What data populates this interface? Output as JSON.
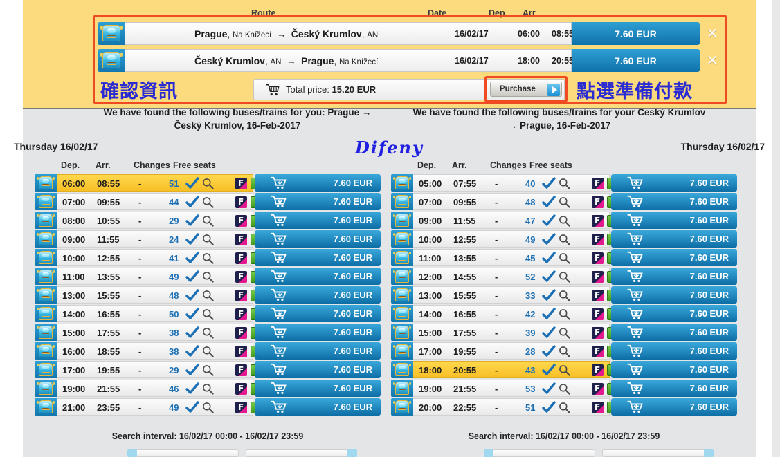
{
  "banner": {
    "columns": {
      "route": "Route",
      "date": "Date",
      "dep": "Dep.",
      "arr": "Arr."
    },
    "items": [
      {
        "from_city": "Prague",
        "from_stop": "Na Knížecí",
        "to_city": "Český Krumlov",
        "to_stop": "AN",
        "date": "16/02/17",
        "dep": "06:00",
        "arr": "08:55",
        "price": "7.60 EUR",
        "remove": "✕"
      },
      {
        "from_city": "Český Krumlov",
        "from_stop": "AN",
        "to_city": "Prague",
        "to_stop": "Na Knížecí",
        "date": "16/02/17",
        "dep": "18:00",
        "arr": "20:55",
        "price": "7.60 EUR",
        "remove": "✕"
      }
    ],
    "annotation_left": "確認資訊",
    "annotation_right": "點選準備付款",
    "total_label": "Total price:",
    "total_value": "15.20 EUR",
    "purchase_label": "Purchase",
    "highlight_color": "#f04a23",
    "background_color": "#fcdb7e"
  },
  "found_text": {
    "left": "We have found the following buses/trains for you: Prague → Český Krumlov, 16-Feb-2017",
    "right": "We have found the following buses/trains for your Český Krumlov → Prague, 16-Feb-2017"
  },
  "dayband": {
    "left_day": "Thursday 16/02/17",
    "right_day": "Thursday 16/02/17",
    "brand": "Difeny"
  },
  "table_headers": {
    "dep": "Dep.",
    "arr": "Arr.",
    "changes": "Changes",
    "free_seats": "Free seats"
  },
  "footer": {
    "left_interval": "Search interval: 16/02/17 00:00 - 16/02/17 23:59",
    "right_interval": "Search interval: 16/02/17 00:00 - 16/02/17 23:59"
  },
  "icons": {
    "check": "check-mark",
    "magnifier": "magnifier",
    "facebook": "F",
    "info": "i",
    "cart": "shopping-cart"
  },
  "left_table": {
    "rows": [
      {
        "dep": "06:00",
        "arr": "08:55",
        "changes": "-",
        "seats": "51",
        "price": "7.60 EUR",
        "selected": true
      },
      {
        "dep": "07:00",
        "arr": "09:55",
        "changes": "-",
        "seats": "44",
        "price": "7.60 EUR",
        "selected": false
      },
      {
        "dep": "08:00",
        "arr": "10:55",
        "changes": "-",
        "seats": "29",
        "price": "7.60 EUR",
        "selected": false
      },
      {
        "dep": "09:00",
        "arr": "11:55",
        "changes": "-",
        "seats": "24",
        "price": "7.60 EUR",
        "selected": false
      },
      {
        "dep": "10:00",
        "arr": "12:55",
        "changes": "-",
        "seats": "41",
        "price": "7.60 EUR",
        "selected": false
      },
      {
        "dep": "11:00",
        "arr": "13:55",
        "changes": "-",
        "seats": "49",
        "price": "7.60 EUR",
        "selected": false
      },
      {
        "dep": "13:00",
        "arr": "15:55",
        "changes": "-",
        "seats": "48",
        "price": "7.60 EUR",
        "selected": false
      },
      {
        "dep": "14:00",
        "arr": "16:55",
        "changes": "-",
        "seats": "50",
        "price": "7.60 EUR",
        "selected": false
      },
      {
        "dep": "15:00",
        "arr": "17:55",
        "changes": "-",
        "seats": "38",
        "price": "7.60 EUR",
        "selected": false
      },
      {
        "dep": "16:00",
        "arr": "18:55",
        "changes": "-",
        "seats": "38",
        "price": "7.60 EUR",
        "selected": false
      },
      {
        "dep": "17:00",
        "arr": "19:55",
        "changes": "-",
        "seats": "29",
        "price": "7.60 EUR",
        "selected": false
      },
      {
        "dep": "19:00",
        "arr": "21:55",
        "changes": "-",
        "seats": "46",
        "price": "7.60 EUR",
        "selected": false
      },
      {
        "dep": "21:00",
        "arr": "23:55",
        "changes": "-",
        "seats": "49",
        "price": "7.60 EUR",
        "selected": false
      }
    ]
  },
  "right_table": {
    "rows": [
      {
        "dep": "05:00",
        "arr": "07:55",
        "changes": "-",
        "seats": "40",
        "price": "7.60 EUR",
        "selected": false
      },
      {
        "dep": "07:00",
        "arr": "09:55",
        "changes": "-",
        "seats": "48",
        "price": "7.60 EUR",
        "selected": false
      },
      {
        "dep": "09:00",
        "arr": "11:55",
        "changes": "-",
        "seats": "47",
        "price": "7.60 EUR",
        "selected": false
      },
      {
        "dep": "10:00",
        "arr": "12:55",
        "changes": "-",
        "seats": "49",
        "price": "7.60 EUR",
        "selected": false
      },
      {
        "dep": "11:00",
        "arr": "13:55",
        "changes": "-",
        "seats": "45",
        "price": "7.60 EUR",
        "selected": false
      },
      {
        "dep": "12:00",
        "arr": "14:55",
        "changes": "-",
        "seats": "52",
        "price": "7.60 EUR",
        "selected": false
      },
      {
        "dep": "13:00",
        "arr": "15:55",
        "changes": "-",
        "seats": "33",
        "price": "7.60 EUR",
        "selected": false
      },
      {
        "dep": "14:00",
        "arr": "16:55",
        "changes": "-",
        "seats": "42",
        "price": "7.60 EUR",
        "selected": false
      },
      {
        "dep": "15:00",
        "arr": "17:55",
        "changes": "-",
        "seats": "39",
        "price": "7.60 EUR",
        "selected": false
      },
      {
        "dep": "17:00",
        "arr": "19:55",
        "changes": "-",
        "seats": "28",
        "price": "7.60 EUR",
        "selected": false
      },
      {
        "dep": "18:00",
        "arr": "20:55",
        "changes": "-",
        "seats": "43",
        "price": "7.60 EUR",
        "selected": true
      },
      {
        "dep": "19:00",
        "arr": "21:55",
        "changes": "-",
        "seats": "53",
        "price": "7.60 EUR",
        "selected": false
      },
      {
        "dep": "20:00",
        "arr": "22:55",
        "changes": "-",
        "seats": "51",
        "price": "7.60 EUR",
        "selected": false
      }
    ]
  }
}
